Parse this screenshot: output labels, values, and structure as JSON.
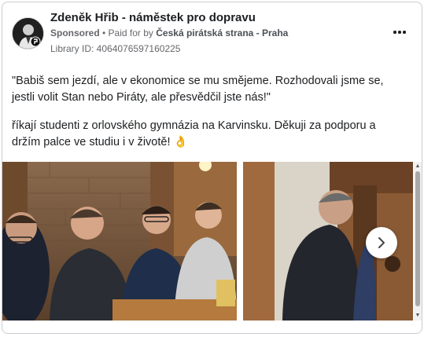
{
  "post": {
    "author": "Zdeněk Hřib - náměstek pro dopravu",
    "sponsored": "Sponsored",
    "paid_for_prefix": "• Paid for by",
    "payer": "Česká pirátská strana - Praha",
    "library_id": "Library ID: 4064076597160225",
    "paragraph1": "\"Babiš sem jezdí, ale v ekonomice se mu smějeme. Rozhodovali jsme se, jestli volit Stan nebo Piráty, ale přesvědčil jste nás!\"",
    "paragraph2": "říkají studenti z orlovského gymnázia na Karvinsku. Děkuji za podporu a držím palce ve studiu i v životě! 👌"
  },
  "icons": {
    "more": "more-options-icon",
    "next": "chevron-right-icon",
    "emoji": "ok-hand-emoji"
  }
}
